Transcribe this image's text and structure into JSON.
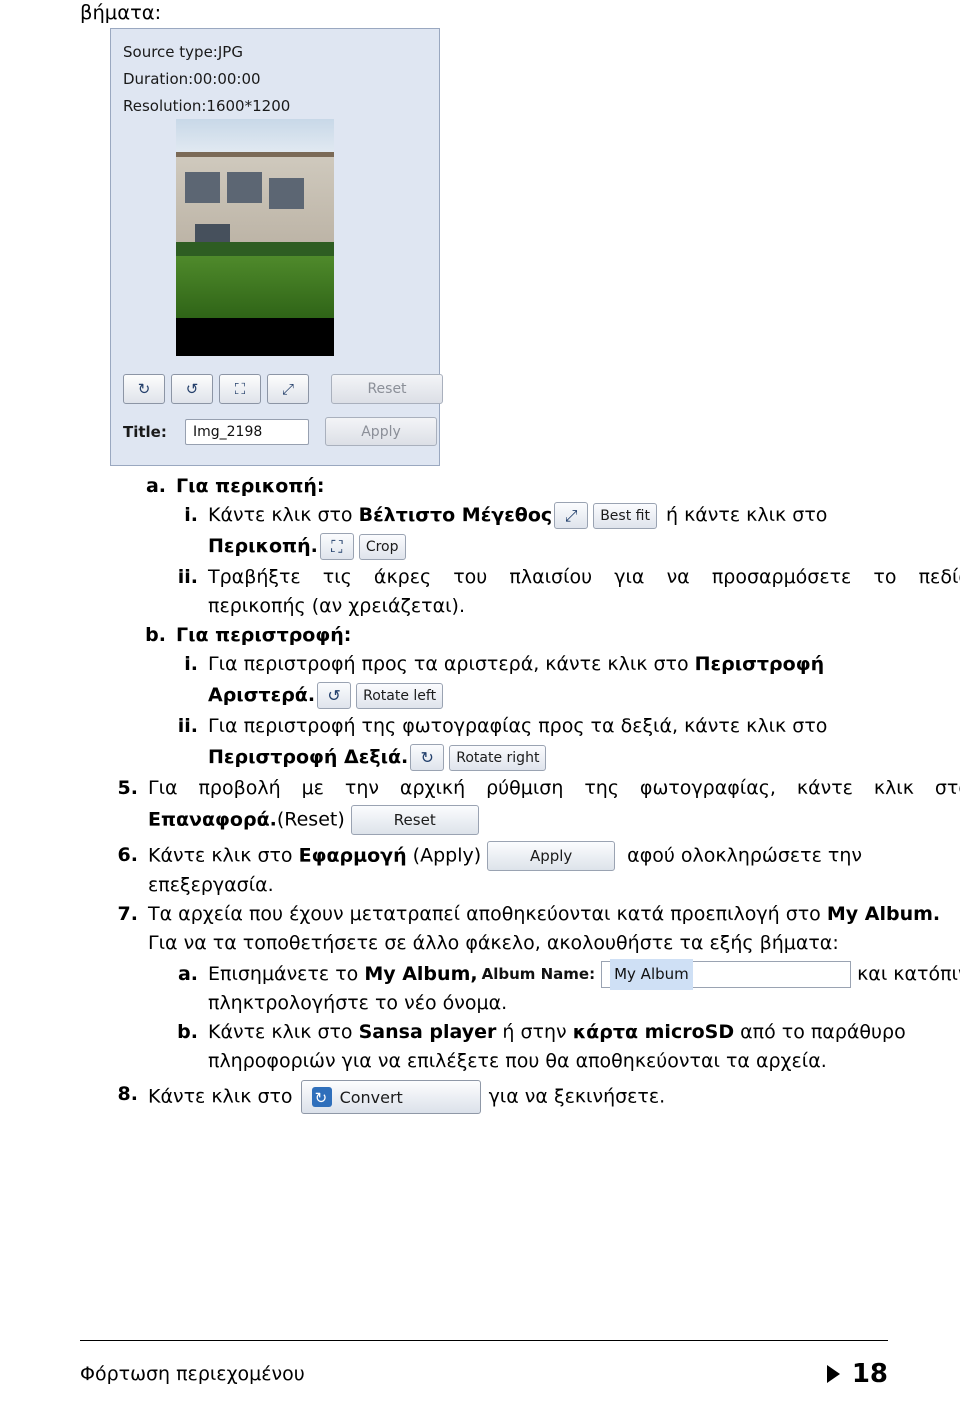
{
  "document": {
    "top_fragment": "βήματα:",
    "footer_text": "Φόρτωση περιεχομένου",
    "page_number": "18"
  },
  "screenshot": {
    "info_lines": [
      "Source type:JPG",
      "Duration:00:00:00",
      "Resolution:1600*1200"
    ],
    "toolbar_icons": [
      "rotate-right-icon",
      "rotate-left-icon",
      "crop-icon",
      "best-fit-icon"
    ],
    "reset_label": "Reset",
    "title_label": "Title:",
    "title_value": "Img_2198",
    "apply_label": "Apply"
  },
  "steps": {
    "a": {
      "marker": "a.",
      "label": "Για περικοπή:"
    },
    "a_i": {
      "marker": "i.",
      "text_1": "Κάντε κλικ στο ",
      "bold_1": "Βέλτιστο Μέγεθος",
      "best_fit_label": "Best fit",
      "text_2": "ή κάντε κλικ στο",
      "bold_2": "Περικοπή.",
      "crop_label": "Crop"
    },
    "a_ii": {
      "marker": "ii.",
      "line_1": "Τραβήξτε τις άκρες του πλαισίου για να προσαρμόσετε το πεδίο",
      "line_2": "περικοπής (αν χρειάζεται)."
    },
    "b": {
      "marker": "b.",
      "label": "Για περιστροφή:"
    },
    "b_i": {
      "marker": "i.",
      "text_1": "Για περιστροφή προς τα αριστερά, κάντε κλικ στο ",
      "bold_1": "Περιστροφή",
      "bold_2": "Αριστερά.",
      "rotate_left_label": "Rotate left"
    },
    "b_ii": {
      "marker": "ii.",
      "text_1": "Για περιστροφή της φωτογραφίας προς τα δεξιά, κάντε κλικ στο",
      "bold_1": "Περιστροφή Δεξιά.",
      "rotate_right_label": "Rotate right"
    },
    "s5": {
      "marker": "5.",
      "text_1": "Για προβολή με την αρχική ρύθμιση της φωτογραφίας, κάντε κλικ στο",
      "bold_1": "Επαναφορά.",
      "paren_1": "(Reset)",
      "reset_label": "Reset"
    },
    "s6": {
      "marker": "6.",
      "text_1": "Κάντε κλικ στο ",
      "bold_1": "Εφαρμογή",
      "paren_1": "(Apply)",
      "apply_label": "Apply",
      "text_2": "αφού ολοκληρώσετε την",
      "text_3": "επεξεργασία."
    },
    "s7": {
      "marker": "7.",
      "text_1": "Τα αρχεία που έχουν μετατραπεί αποθηκεύονται κατά προεπιλογή στο ",
      "bold_1": "My Album.",
      "text_2": "Για να τα τοποθετήσετε σε άλλο φάκελο, ακολουθήστε τα εξής βήματα:"
    },
    "s7_a": {
      "marker": "a.",
      "text_1": "Επισημάνετε το ",
      "bold_1": "My Album,",
      "album_name_label": "Album Name:",
      "album_name_value": "My Album",
      "text_2": "και κατόπιν",
      "text_3": "πληκτρολογήστε το νέο όνομα."
    },
    "s7_b": {
      "marker": "b.",
      "text_1": "Κάντε κλικ στο ",
      "bold_1": "Sansa player",
      "text_2": " ή στην ",
      "bold_2": "κάρτα microSD",
      "text_3": " από το παράθυρο",
      "text_4": "πληροφοριών για να επιλέξετε που θα αποθηκεύονται τα αρχεία."
    },
    "s8": {
      "marker": "8.",
      "text_1": "Κάντε κλικ στο",
      "convert_label": "Convert",
      "text_2": "για να ξεκινήσετε."
    }
  }
}
